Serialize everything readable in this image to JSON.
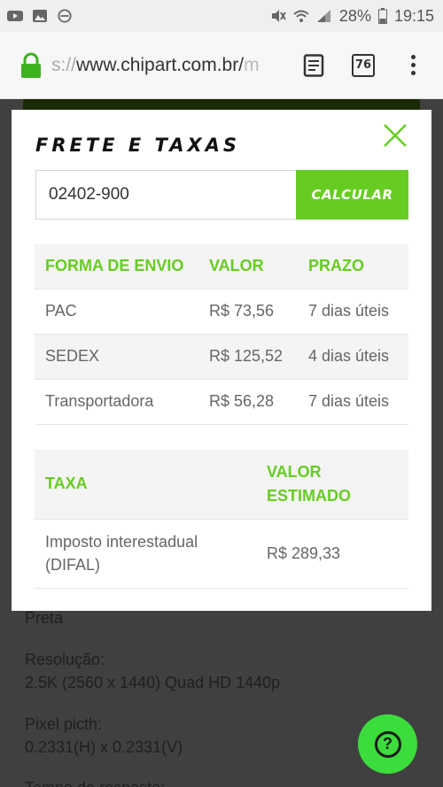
{
  "statusbar": {
    "battery": "28%",
    "time": "19:15"
  },
  "browser": {
    "url_faded": "s://",
    "url_main": "www.chipart.com.br/",
    "url_tail": "m",
    "tab_count": "76"
  },
  "background": {
    "line1": "Preta",
    "line2": "Resolução:",
    "line3": "2.5K (2560 x 1440) Quad HD 1440p",
    "line4": "Pixel picth:",
    "line5": "0.2331(H) x 0.2331(V)",
    "line6": "Tempo de resposta:"
  },
  "modal": {
    "title": "FRETE E TAXAS",
    "cep_value": "02402-900",
    "calc_label": "CALCULAR",
    "shipping": {
      "headers": [
        "FORMA DE ENVIO",
        "VALOR",
        "PRAZO"
      ],
      "rows": [
        [
          "PAC",
          "R$ 73,56",
          "7 dias úteis"
        ],
        [
          "SEDEX",
          "R$ 125,52",
          "4 dias úteis"
        ],
        [
          "Transportadora",
          "R$ 56,28",
          "7 dias úteis"
        ]
      ]
    },
    "taxes": {
      "headers": [
        "TAXA",
        "VALOR ESTIMADO"
      ],
      "rows": [
        [
          "Imposto interestadual (DIFAL)",
          "R$ 289,33"
        ]
      ]
    }
  },
  "fab": {
    "label": "?"
  },
  "colors": {
    "accent": "#66cc22",
    "fab": "#3cdc3c"
  }
}
